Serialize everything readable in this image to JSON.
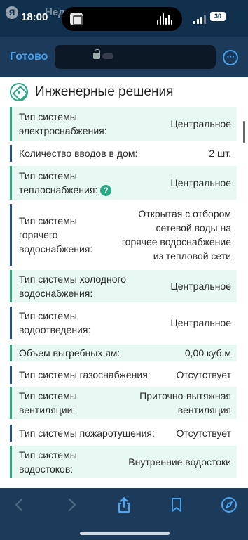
{
  "status_bar": {
    "time": "18:00",
    "watermark_logo": "Я",
    "watermark_text": "Недвижимость",
    "battery": "30"
  },
  "nav": {
    "done_label": "Готово",
    "more_icon": "ellipsis-circle-icon"
  },
  "section": {
    "title": "Инженерные решения",
    "icon": "gear-badge-icon",
    "accent_color": "#2aa784"
  },
  "rows": [
    {
      "label": "Тип системы электроснабжения:",
      "value": "Центральное"
    },
    {
      "label": "Количество вводов в дом:",
      "value": "2 шт."
    },
    {
      "label": "Тип системы теплоснабжения:",
      "value": "Центральное",
      "help": "?"
    },
    {
      "label": "Тип системы горячего водоснабжения:",
      "value": "Открытая с отбором сетевой воды на горячее водоснабжение из тепловой сети"
    },
    {
      "label": "Тип системы холодного водоснабжения:",
      "value": "Центральное"
    },
    {
      "label": "Тип системы водоотведения:",
      "value": "Центральное"
    },
    {
      "label": "Объем выгребных ям:",
      "value": "0,00 куб.м"
    },
    {
      "label": "Тип системы газоснабжения:",
      "value": "Отсутствует"
    },
    {
      "label": "Тип системы вентиляции:",
      "value": "Приточно-вытяжная вентиляция"
    },
    {
      "label": "Тип системы пожаротушения:",
      "value": "Отсутствует"
    },
    {
      "label": "Тип системы водостоков:",
      "value": "Внутренние водостоки"
    }
  ],
  "toolbar": {
    "back_icon": "chevron-left-icon",
    "forward_icon": "chevron-right-icon",
    "share_icon": "share-icon",
    "bookmark_icon": "bookmark-icon",
    "safari_icon": "compass-icon"
  }
}
